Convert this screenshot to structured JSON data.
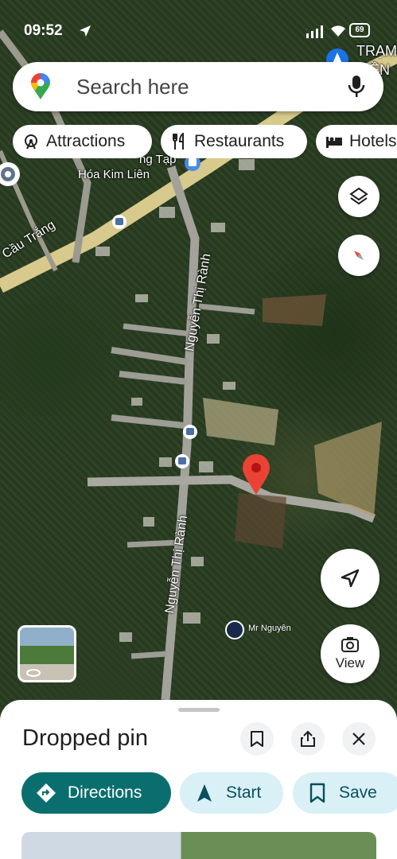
{
  "status_bar": {
    "time": "09:52",
    "battery": "69"
  },
  "search": {
    "placeholder": "Search here"
  },
  "chips": [
    {
      "label": "Attractions",
      "icon": "ferris-wheel-icon"
    },
    {
      "label": "Restaurants",
      "icon": "fork-knife-icon"
    },
    {
      "label": "Hotels",
      "icon": "bed-icon"
    }
  ],
  "map_labels": {
    "road_1": "Cầu Trắng",
    "road_2_top": "Nguyễn Thị Rành",
    "road_2_bottom": "Nguyễn Thị Rành",
    "shop_line1": "ng Tạp",
    "shop_line2": "Hóa Kim Liên",
    "tram_line1": "TRẠM",
    "tram_line2": "IỀN",
    "user_name": "Mr Nguyên"
  },
  "view_button": {
    "label": "View"
  },
  "sheet": {
    "title": "Dropped pin",
    "actions": [
      {
        "label": "Directions",
        "icon": "directions-icon"
      },
      {
        "label": "Start",
        "icon": "navigation-arrow-icon"
      },
      {
        "label": "Save",
        "icon": "bookmark-icon"
      }
    ]
  },
  "colors": {
    "accent": "#0b6e6e",
    "accent_light": "#d8f0f6",
    "pin_red": "#ea4335"
  }
}
